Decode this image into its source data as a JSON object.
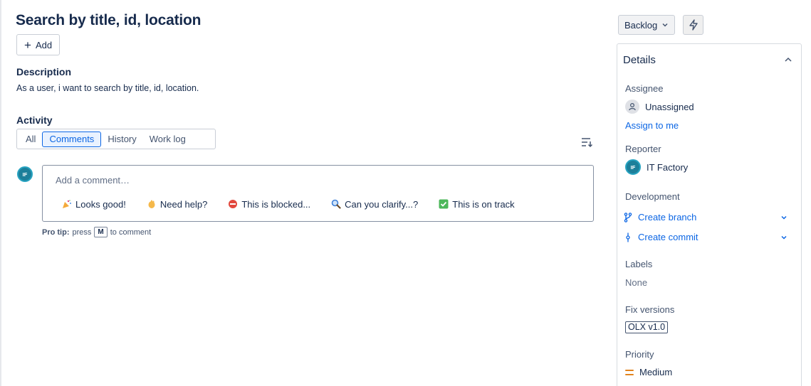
{
  "issue": {
    "title": "Search by title, id, location",
    "add_label": "Add",
    "description_heading": "Description",
    "description_text": "As a user, i want to search by title, id, location."
  },
  "activity": {
    "heading": "Activity",
    "tabs": [
      {
        "label": "All",
        "active": false
      },
      {
        "label": "Comments",
        "active": true
      },
      {
        "label": "History",
        "active": false
      },
      {
        "label": "Work log",
        "active": false
      }
    ],
    "avatar_initials": "IF",
    "comment_placeholder": "Add a comment…",
    "quick_replies": [
      {
        "emoji": "party-popper-icon",
        "label": "Looks good!"
      },
      {
        "emoji": "waving-hand-icon",
        "label": "Need help?"
      },
      {
        "emoji": "no-entry-icon",
        "label": "This is blocked..."
      },
      {
        "emoji": "magnifier-icon",
        "label": "Can you clarify...?"
      },
      {
        "emoji": "check-box-icon",
        "label": "This is on track"
      }
    ],
    "pro_tip_label": "Pro tip:",
    "pro_tip_press": "press",
    "pro_tip_key": "M",
    "pro_tip_suffix": "to comment"
  },
  "status": {
    "label": "Backlog"
  },
  "details": {
    "heading": "Details",
    "assignee_label": "Assignee",
    "assignee_value": "Unassigned",
    "assign_to_me": "Assign to me",
    "reporter_label": "Reporter",
    "reporter_initials": "IF",
    "reporter_value": "IT Factory",
    "development_label": "Development",
    "create_branch": "Create branch",
    "create_commit": "Create commit",
    "labels_label": "Labels",
    "labels_value": "None",
    "fix_versions_label": "Fix versions",
    "fix_version_value": "OLX v1.0",
    "priority_label": "Priority",
    "priority_value": "Medium"
  },
  "colors": {
    "link": "#0c66e4",
    "text": "#172b4d",
    "avatar": "#1d7f9a",
    "priority_medium": "#e2831d"
  }
}
